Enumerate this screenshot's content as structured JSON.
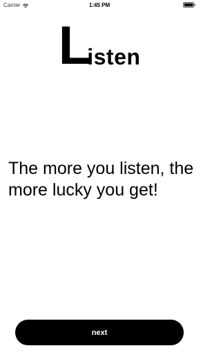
{
  "status_bar": {
    "carrier": "Carrier",
    "time": "1:45 PM",
    "wifi_icon": "wifi-icon",
    "battery_icon": "battery-icon"
  },
  "logo": {
    "initial": "L",
    "rest": "isten"
  },
  "message": "The more you listen, the more lucky you get!",
  "next_button": {
    "label": "next"
  },
  "colors": {
    "background": "#ffffff",
    "text": "#000000",
    "button_bg": "#000000",
    "button_text": "#ffffff"
  }
}
